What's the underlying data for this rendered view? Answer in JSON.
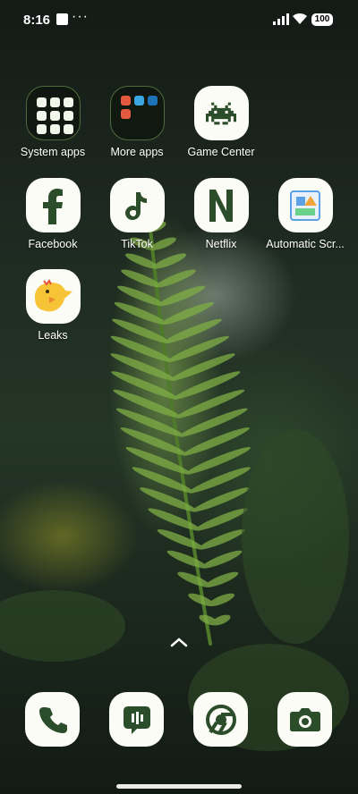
{
  "status_bar": {
    "time": "8:16",
    "battery": "100"
  },
  "apps": [
    {
      "label": "System apps",
      "icon": "folder-icon"
    },
    {
      "label": "More apps",
      "icon": "folder-icon"
    },
    {
      "label": "Game Center",
      "icon": "space-invader-icon"
    },
    {
      "label": "Facebook",
      "icon": "facebook-icon"
    },
    {
      "label": "TikTok",
      "icon": "music-note-icon"
    },
    {
      "label": "Netflix",
      "icon": "netflix-n-icon"
    },
    {
      "label": "Automatic Scr...",
      "icon": "screenshot-icon"
    },
    {
      "label": "Leaks",
      "icon": "chick-icon"
    }
  ],
  "dock": [
    {
      "name": "phone",
      "icon": "phone-icon"
    },
    {
      "name": "messages",
      "icon": "message-icon"
    },
    {
      "name": "chrome",
      "icon": "chrome-icon"
    },
    {
      "name": "camera",
      "icon": "camera-icon"
    }
  ],
  "colors": {
    "icon_background": "#fbfcf6",
    "icon_glyph": "#2c4d2a",
    "wallpaper_dark": "#141a16",
    "wallpaper_fern": "#6f9a3a"
  }
}
